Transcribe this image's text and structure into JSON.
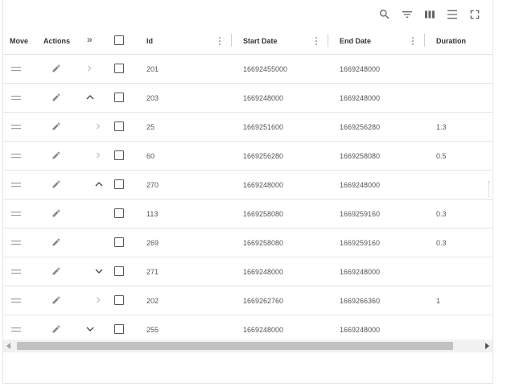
{
  "toolbar": {
    "icons": [
      "search-icon",
      "filter-icon",
      "columns-icon",
      "density-icon",
      "fullscreen-icon"
    ]
  },
  "columns": {
    "move": "Move",
    "actions": "Actions",
    "expand_all": "»",
    "id": "Id",
    "start_date": "Start Date",
    "end_date": "End Date",
    "duration": "Duration"
  },
  "rows": [
    {
      "expand": "collapsed",
      "indent": 0,
      "id": "201",
      "start": "16692455000",
      "end": "1669248000",
      "duration": ""
    },
    {
      "expand": "expanded",
      "indent": 0,
      "id": "203",
      "start": "1669248000",
      "end": "1669248000",
      "duration": ""
    },
    {
      "expand": "collapsed",
      "indent": 1,
      "id": "25",
      "start": "1669251600",
      "end": "1669256280",
      "duration": "1.3"
    },
    {
      "expand": "collapsed",
      "indent": 1,
      "id": "60",
      "start": "1669256280",
      "end": "1669258080",
      "duration": "0.5"
    },
    {
      "expand": "expanded",
      "indent": 1,
      "id": "270",
      "start": "1669248000",
      "end": "1669248000",
      "duration": ""
    },
    {
      "expand": "none",
      "indent": 2,
      "id": "113",
      "start": "1669258080",
      "end": "1669259160",
      "duration": "0.3"
    },
    {
      "expand": "none",
      "indent": 2,
      "id": "269",
      "start": "1669258080",
      "end": "1669259160",
      "duration": "0.3"
    },
    {
      "expand": "down",
      "indent": 1,
      "id": "271",
      "start": "1669248000",
      "end": "1669248000",
      "duration": ""
    },
    {
      "expand": "collapsed",
      "indent": 1,
      "id": "202",
      "start": "1669262760",
      "end": "1669266360",
      "duration": "1"
    },
    {
      "expand": "down",
      "indent": 0,
      "id": "255",
      "start": "1669248000",
      "end": "1669248000",
      "duration": ""
    }
  ]
}
